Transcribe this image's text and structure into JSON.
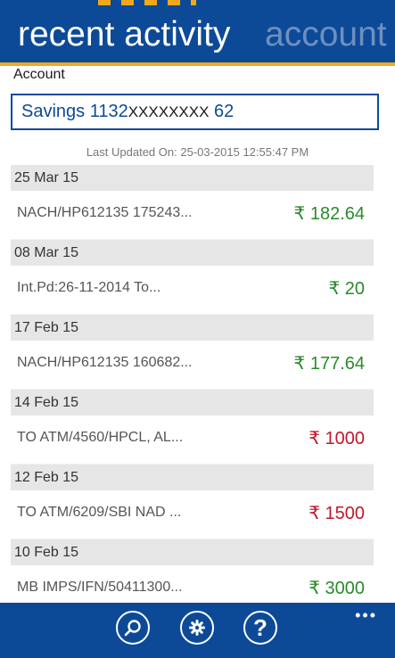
{
  "header": {
    "active_pivot": "recent activity",
    "inactive_pivot": "account"
  },
  "account": {
    "label": "Account",
    "value_prefix": "Savings 1132",
    "value_masked": "XXXXXXXX",
    "value_suffix": " 62"
  },
  "last_updated": "Last Updated On: 25-03-2015 12:55:47 PM",
  "transactions": [
    {
      "date": "25 Mar 15",
      "desc": "NACH/HP612135 175243...",
      "amount": "₹ 182.64",
      "type": "credit"
    },
    {
      "date": "08 Mar 15",
      "desc": "Int.Pd:26-11-2014 To...",
      "amount": "₹ 20",
      "type": "credit"
    },
    {
      "date": "17 Feb 15",
      "desc": "NACH/HP612135 160682...",
      "amount": "₹ 177.64",
      "type": "credit"
    },
    {
      "date": "14 Feb 15",
      "desc": "TO ATM/4560/HPCL, AL...",
      "amount": "₹ 1000",
      "type": "debit"
    },
    {
      "date": "12 Feb 15",
      "desc": "TO ATM/6209/SBI NAD ...",
      "amount": "₹ 1500",
      "type": "debit"
    },
    {
      "date": "10 Feb 15",
      "desc": "MB IMPS/IFN/50411300...",
      "amount": "₹ 3000",
      "type": "credit"
    }
  ],
  "app_bar": {
    "buttons": [
      {
        "icon": "search-icon"
      },
      {
        "icon": "gear-icon"
      },
      {
        "icon": "help-icon",
        "glyph": "?"
      }
    ],
    "more": "•••"
  },
  "colors": {
    "primary": "#0c4a98",
    "accent": "#f0a91f",
    "credit": "#2a8a2a",
    "debit": "#c2162b"
  }
}
